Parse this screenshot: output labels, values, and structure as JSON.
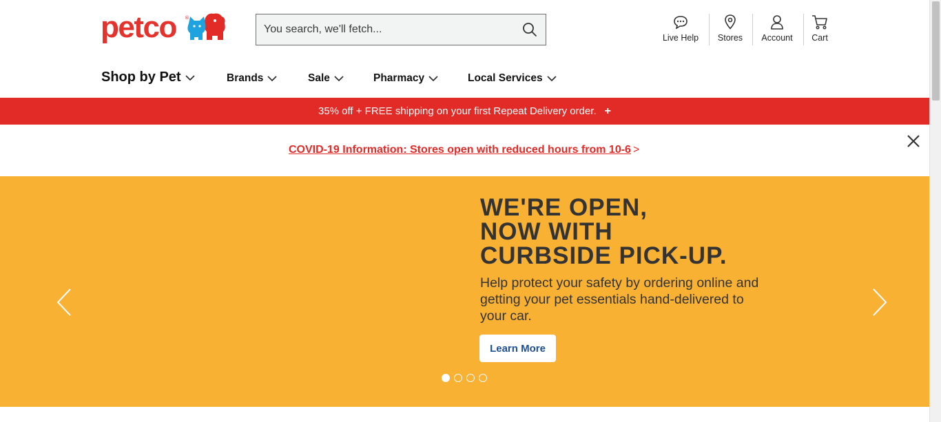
{
  "header": {
    "logo_text": "petco",
    "search": {
      "placeholder": "You search, we'll fetch..."
    },
    "utility": [
      {
        "label": "Live Help",
        "icon": "chat-bubble-icon"
      },
      {
        "label": "Stores",
        "icon": "location-pin-icon"
      },
      {
        "label": "Account",
        "icon": "user-icon"
      },
      {
        "label": "Cart",
        "icon": "cart-icon"
      }
    ]
  },
  "nav": {
    "items": [
      {
        "label": "Shop by Pet"
      },
      {
        "label": "Brands"
      },
      {
        "label": "Sale"
      },
      {
        "label": "Pharmacy"
      },
      {
        "label": "Local Services"
      }
    ]
  },
  "promo": {
    "text": "35% off + FREE shipping on your first Repeat Delivery order.",
    "expand": "+"
  },
  "notice": {
    "link_text": "COVID-19 Information: Stores open with reduced hours from 10-6",
    "arrow": ">"
  },
  "hero": {
    "title_lines": [
      "WE'RE OPEN,",
      "NOW WITH",
      "CURBSIDE PICK-UP."
    ],
    "body": "Help protect your safety by ordering online and getting your pet essentials hand-delivered to your car.",
    "cta": "Learn More",
    "slides_total": 4,
    "active_slide": 1
  },
  "colors": {
    "brand_red": "#e22a27",
    "hero_bg": "#f8b133",
    "cta_text": "#1d4f91"
  }
}
